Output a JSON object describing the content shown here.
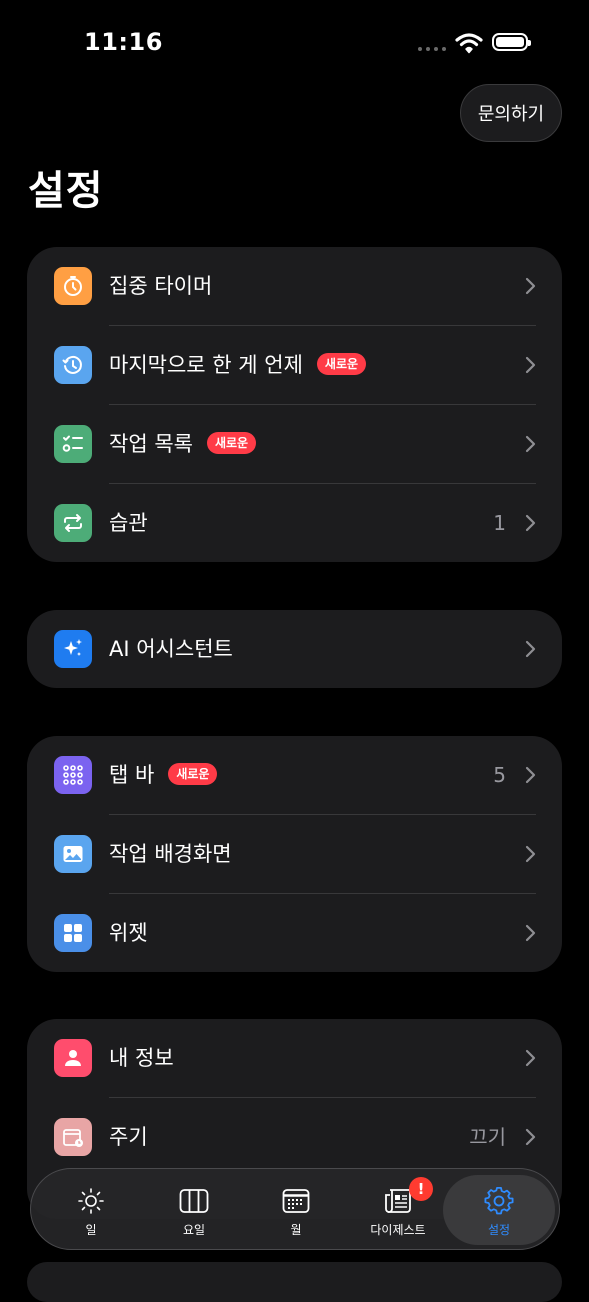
{
  "status_bar": {
    "time": "11:16"
  },
  "header": {
    "contact_button": "문의하기",
    "title": "설정"
  },
  "groups": [
    {
      "items": [
        {
          "label": "집중 타이머",
          "icon": "timer-icon",
          "color": "#ff9f43"
        },
        {
          "label": "마지막으로 한 게 언제",
          "icon": "history-icon",
          "color": "#5aa5ef",
          "badge": "새로운"
        },
        {
          "label": "작업 목록",
          "icon": "checklist-icon",
          "color": "#4dac78",
          "badge": "새로운"
        },
        {
          "label": "습관",
          "icon": "repeat-icon",
          "color": "#4dac78",
          "value": "1"
        }
      ]
    },
    {
      "items": [
        {
          "label": "AI 어시스턴트",
          "icon": "sparkles-icon",
          "color": "#1f7cf0"
        }
      ]
    },
    {
      "items": [
        {
          "label": "탭 바",
          "icon": "grid-dots-icon",
          "color": "#7b63f0",
          "badge": "새로운",
          "value": "5"
        },
        {
          "label": "작업 배경화면",
          "icon": "photo-icon",
          "color": "#5aa5ef"
        },
        {
          "label": "위젯",
          "icon": "widgets-icon",
          "color": "#4a8fe8"
        }
      ]
    },
    {
      "items": [
        {
          "label": "내 정보",
          "icon": "person-icon",
          "color": "#ff4d6d"
        },
        {
          "label": "주기",
          "icon": "calendar-badge-icon",
          "color": "#e8a5a5",
          "value": "끄기"
        }
      ]
    }
  ],
  "tab_bar": {
    "tabs": [
      {
        "label": "일",
        "icon": "sun-icon"
      },
      {
        "label": "요일",
        "icon": "columns-icon"
      },
      {
        "label": "월",
        "icon": "calendar-icon"
      },
      {
        "label": "다이제스트",
        "icon": "newspaper-icon",
        "alert": "!"
      },
      {
        "label": "설정",
        "icon": "gear-icon",
        "active": true
      }
    ]
  },
  "accent_color": "#2f8cff",
  "badge_color": "#ff3b47"
}
